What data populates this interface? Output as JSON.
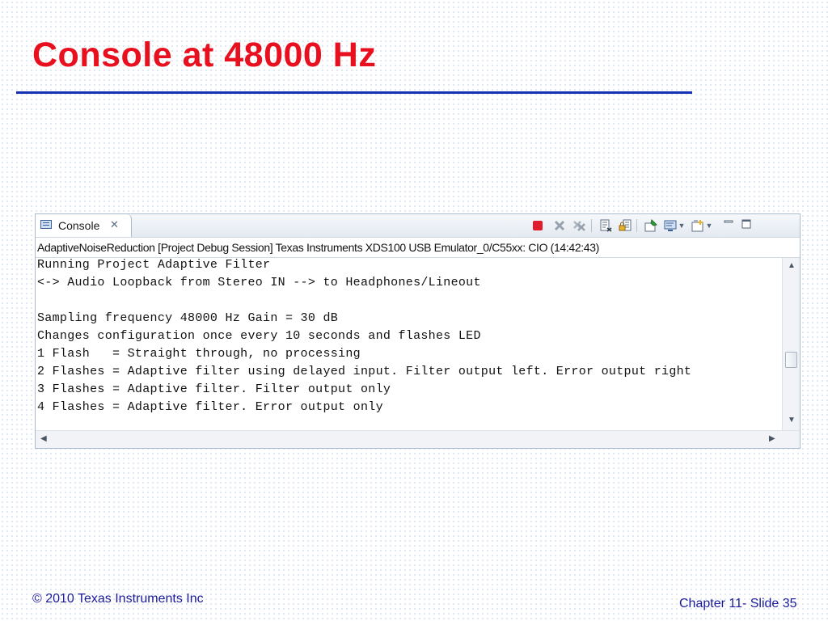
{
  "slide": {
    "title": "Console at 48000 Hz",
    "footer_left": "© 2010 Texas Instruments Inc",
    "footer_right": "Chapter 11- Slide 35"
  },
  "console": {
    "tab_label": "Console",
    "tab_close_glyph": "✕",
    "session_title": "AdaptiveNoiseReduction [Project Debug Session] Texas Instruments XDS100 USB Emulator_0/C55xx: CIO (14:42:43)",
    "output_lines": [
      "Running Project Adaptive Filter",
      "<-> Audio Loopback from Stereo IN --> to Headphones/Lineout",
      "",
      "Sampling frequency 48000 Hz Gain = 30 dB",
      "Changes configuration once every 10 seconds and flashes LED",
      "1 Flash   = Straight through, no processing",
      "2 Flashes = Adaptive filter using delayed input. Filter output left. Error output right",
      "3 Flashes = Adaptive filter. Filter output only",
      "4 Flashes = Adaptive filter. Error output only"
    ],
    "toolbar": {
      "terminate_icon": "stop-icon",
      "remove_launch_icon": "remove-icon",
      "remove_all_icon": "remove-all-icon",
      "clear_console_icon": "clear-console-icon",
      "scroll_lock_icon": "scroll-lock-icon",
      "pin_console_icon": "pin-icon",
      "display_console_icon": "display-console-icon",
      "open_console_icon": "open-console-icon",
      "minimize_icon": "minimize-icon",
      "maximize_icon": "maximize-icon"
    }
  },
  "colors": {
    "title": "#e8101e",
    "rule": "#1530b0",
    "footer_text": "#1a1a99",
    "stop_red": "#e01b2c"
  }
}
